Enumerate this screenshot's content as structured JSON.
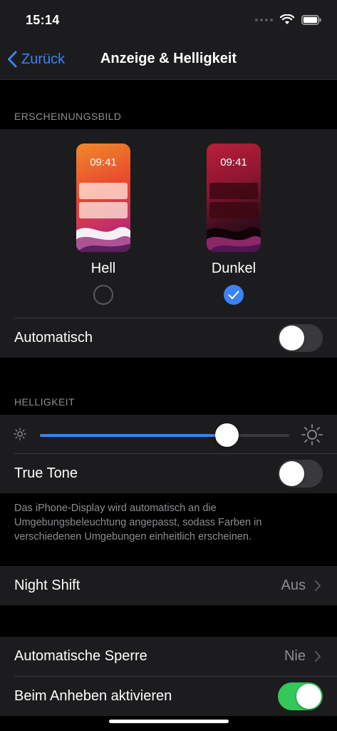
{
  "status_bar": {
    "time": "15:14"
  },
  "nav": {
    "back_label": "Zurück",
    "title": "Anzeige & Helligkeit"
  },
  "appearance": {
    "section_header": "ERSCHEINUNGSBILD",
    "options": [
      {
        "preview_time": "09:41",
        "label": "Hell",
        "selected": false
      },
      {
        "preview_time": "09:41",
        "label": "Dunkel",
        "selected": true
      }
    ],
    "automatic_label": "Automatisch",
    "automatic_on": false
  },
  "brightness": {
    "section_header": "HELLIGKEIT",
    "level": 0.75,
    "true_tone_label": "True Tone",
    "true_tone_on": false,
    "footnote": "Das iPhone-Display wird automatisch an die Umgebungsbeleuchtung angepasst, sodass Farben in verschiedenen Umgebungen einheitlich erscheinen."
  },
  "night_shift": {
    "label": "Night Shift",
    "value": "Aus"
  },
  "lock": {
    "auto_lock_label": "Automatische Sperre",
    "auto_lock_value": "Nie",
    "raise_to_wake_label": "Beim Anheben aktivieren",
    "raise_to_wake_on": true
  },
  "colors": {
    "accent": "#3b82f6",
    "toggle_on": "#34c759",
    "background": "#000000",
    "group": "#1c1c1e"
  }
}
